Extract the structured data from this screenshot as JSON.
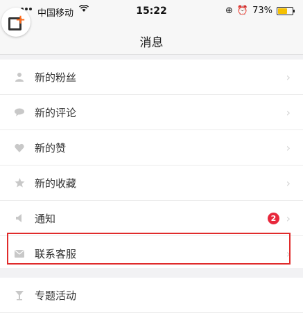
{
  "status_bar": {
    "carrier": "中国移动",
    "time": "15:22",
    "battery": "73%",
    "battery_level": 0.73,
    "wifi_icon": "wifi-icon",
    "alarm_icon": "alarm-icon"
  },
  "nav": {
    "title": "消息"
  },
  "menu": [
    {
      "label": "新的粉丝",
      "icon": "person-icon"
    },
    {
      "label": "新的评论",
      "icon": "comment-icon"
    },
    {
      "label": "新的赞",
      "icon": "heart-icon"
    },
    {
      "label": "新的收藏",
      "icon": "star-icon"
    },
    {
      "label": "通知",
      "icon": "speaker-icon",
      "badge": "2"
    },
    {
      "label": "联系客服",
      "icon": "mail-icon",
      "highlighted": true
    }
  ],
  "menu2": [
    {
      "label": "专题活动",
      "icon": "trophy-icon"
    }
  ],
  "colors": {
    "badge": "#e8283c",
    "highlight": "#e02b2b",
    "app_icon_accent": "#ff6a1a"
  }
}
